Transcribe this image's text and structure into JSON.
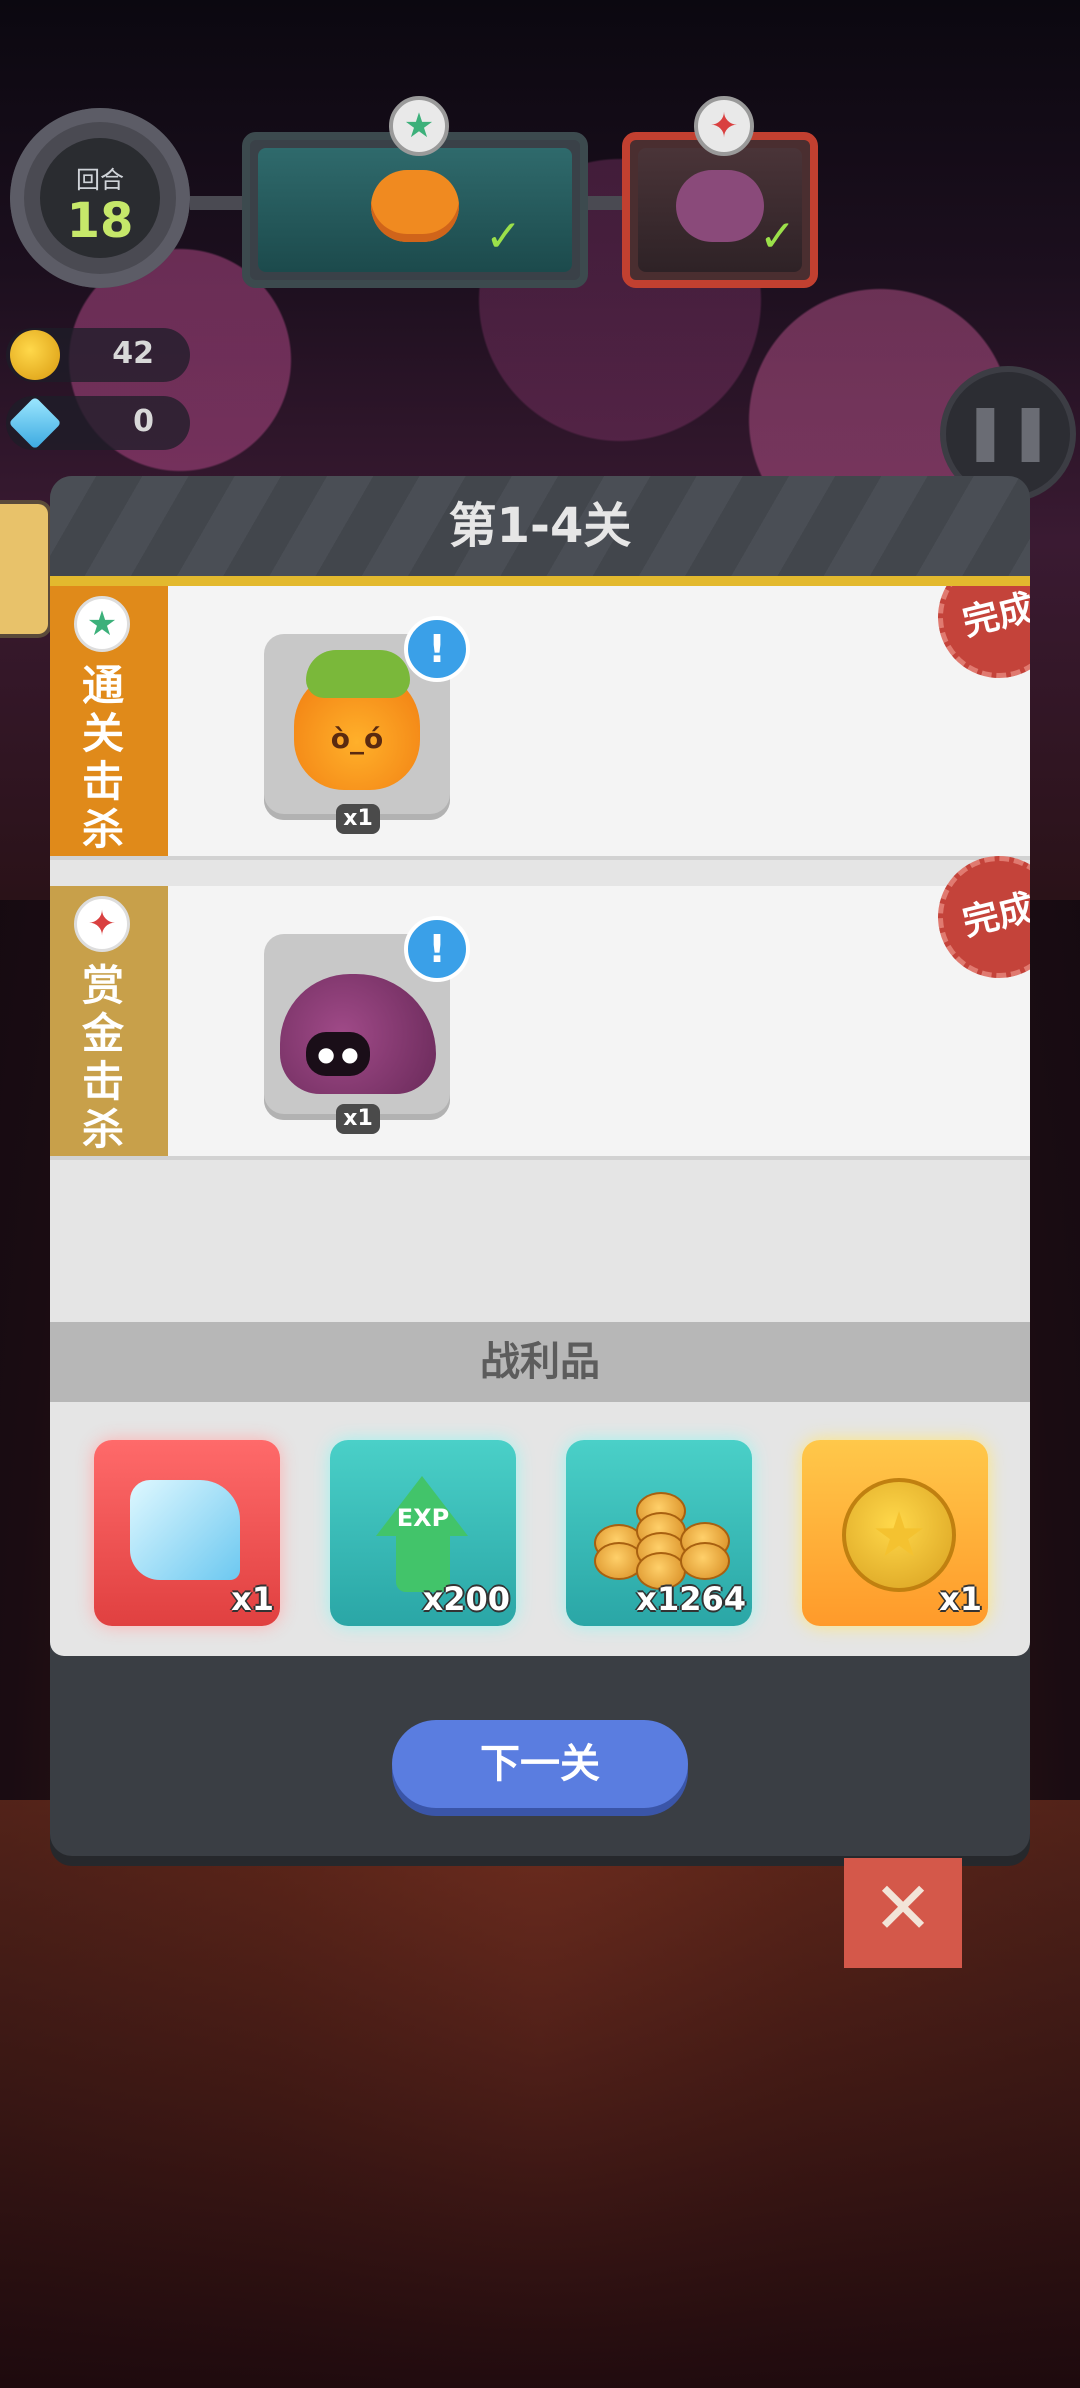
{
  "hud": {
    "round_label": "回合",
    "round_number": "18",
    "coins": "42",
    "gems": "0",
    "stage_green_icon": "star-icon",
    "stage_red_icon": "crosshair-icon"
  },
  "modal": {
    "title": "第1-4关",
    "tasks": [
      {
        "label": "通关击杀",
        "monster": "pumpkin",
        "quantity": "x1",
        "status": "完成",
        "accent": "#e08a1a"
      },
      {
        "label": "赏金击杀",
        "monster": "hedgehog",
        "quantity": "x1",
        "status": "完成",
        "accent": "#c8a04a"
      }
    ],
    "loot_title": "战利品",
    "loot": [
      {
        "name": "crystal",
        "quantity": "x1"
      },
      {
        "name": "exp",
        "icon_text": "EXP",
        "quantity": "x200"
      },
      {
        "name": "coins",
        "quantity": "x1264"
      },
      {
        "name": "star-coin",
        "quantity": "x1"
      }
    ],
    "next_button": "下一关"
  },
  "colors": {
    "accent_blue": "#5a7de0",
    "stamp_red": "#c4433a",
    "header_strip": "#e3b92e"
  }
}
